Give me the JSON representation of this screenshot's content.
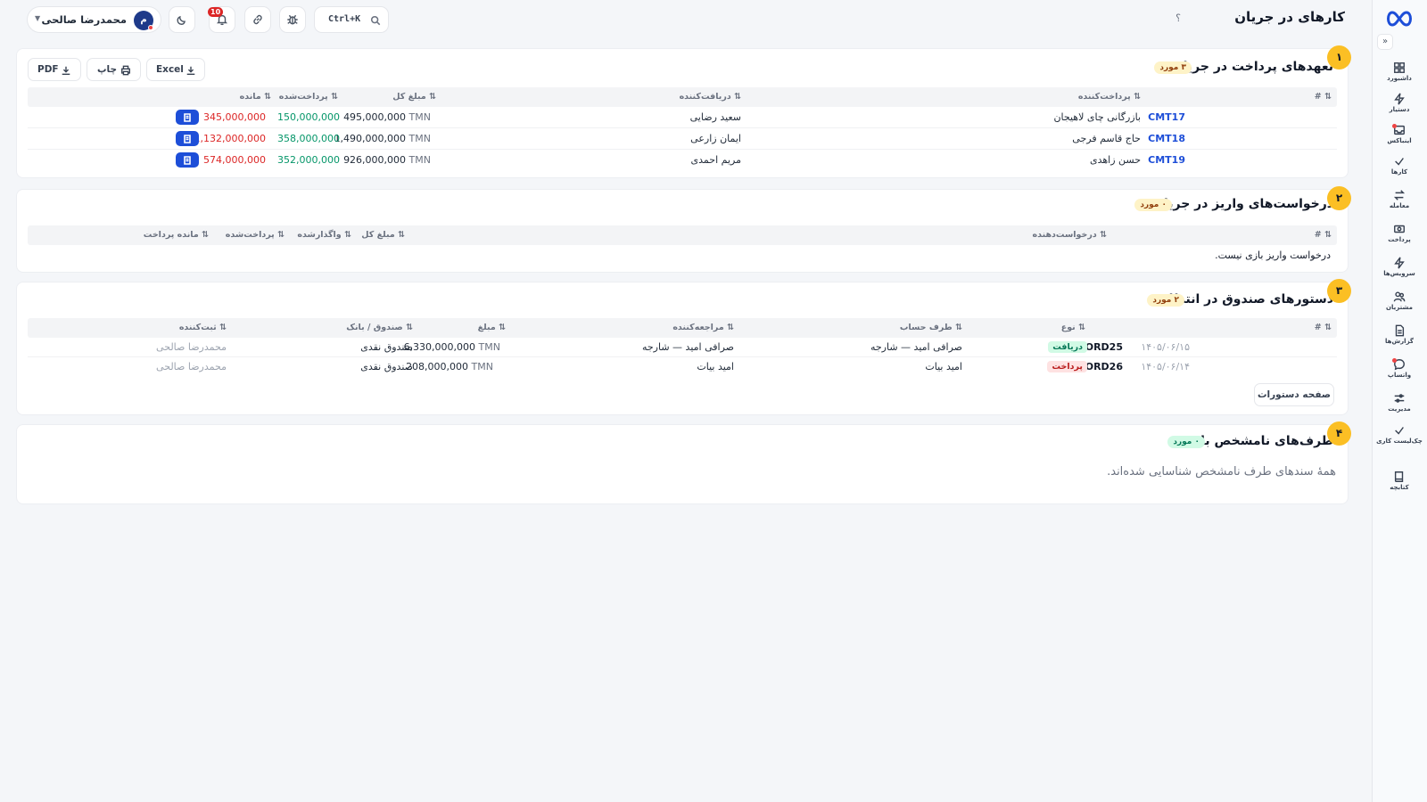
{
  "header": {
    "title": "کارهای در جریان",
    "help": "؟",
    "search_shortcut": "Ctrl+K",
    "notifications_count": "10",
    "user": {
      "name": "محمدرضا صالحی",
      "initial": "م"
    }
  },
  "sidebar": {
    "items": [
      {
        "label": "داشبورد",
        "icon": "dashboard-icon"
      },
      {
        "label": "دستیار",
        "icon": "bolt-icon"
      },
      {
        "label": "اینباکس",
        "icon": "inbox-icon"
      },
      {
        "label": "کارها",
        "icon": "check-icon"
      },
      {
        "label": "معامله",
        "icon": "exchange-icon"
      },
      {
        "label": "پرداخت",
        "icon": "payment-icon"
      },
      {
        "label": "سرویس‌ها",
        "icon": "bolt-icon"
      },
      {
        "label": "مشتریان",
        "icon": "users-icon"
      },
      {
        "label": "گزارش‌ها",
        "icon": "report-icon"
      },
      {
        "label": "واتساپ",
        "icon": "chat-icon"
      },
      {
        "label": "مدیریت",
        "icon": "sliders-icon"
      },
      {
        "label": "چک‌لیست کاری",
        "icon": "check-icon"
      },
      {
        "label": "کتابچه",
        "icon": "book-icon"
      }
    ]
  },
  "section1": {
    "number": "۱",
    "title": "تعهدهای پرداخت در جریان",
    "count": "۳ مورد",
    "toolbar": {
      "excel": "Excel",
      "print": "چاپ",
      "pdf": "PDF"
    },
    "columns": {
      "num": "#",
      "payer": "پرداخت‌کننده",
      "receiver": "دریافت‌کننده",
      "total": "مبلغ کل",
      "paid": "پرداخت‌شده",
      "remaining": "مانده"
    },
    "rows": [
      {
        "code": "CMT17",
        "payer": "بازرگانی چای لاهیجان",
        "receiver": "سعید رضایی",
        "total": "495,000,000",
        "unit": "TMN",
        "paid": "150,000,000",
        "remaining": "345,000,000"
      },
      {
        "code": "CMT18",
        "payer": "حاج قاسم فرجی",
        "receiver": "ایمان زارعی",
        "total": "1,490,000,000",
        "unit": "TMN",
        "paid": "358,000,000",
        "remaining": "1,132,000,000"
      },
      {
        "code": "CMT19",
        "payer": "حسن زاهدی",
        "receiver": "مریم احمدی",
        "total": "926,000,000",
        "unit": "TMN",
        "paid": "352,000,000",
        "remaining": "574,000,000"
      }
    ]
  },
  "section2": {
    "number": "۲",
    "title": "درخواست‌های واریز در جریان",
    "count": "۰ مورد",
    "columns": {
      "num": "#",
      "requester": "درخواست‌دهنده",
      "total": "مبلغ کل",
      "assigned": "واگذارشده",
      "paid": "پرداخت‌شده",
      "remaining": "مانده پرداخت"
    },
    "empty": "درخواست واریز بازی نیست."
  },
  "section3": {
    "number": "۳",
    "title": "دستورهای صندوق در انتظار",
    "count": "۲ مورد",
    "columns": {
      "num": "#",
      "type": "نوع",
      "counterparty": "طرف حساب",
      "client": "مراجعه‌کننده",
      "amount": "مبلغ",
      "fund": "صندوق / بانک",
      "registrar": "ثبت‌کننده"
    },
    "rows": [
      {
        "date": "۱۴۰۵/۰۶/۱۵",
        "code": "ORD25",
        "type": "دریافت",
        "type_kind": "receive",
        "counterparty": "صرافی امید — شارجه",
        "client": "صرافی امید — شارجه",
        "amount": "6,330,000,000",
        "unit": "TMN",
        "fund": "صندوق نقدی",
        "registrar": "محمدرضا صالحی"
      },
      {
        "date": "۱۴۰۵/۰۶/۱۴",
        "code": "ORD26",
        "type": "پرداخت",
        "type_kind": "pay",
        "counterparty": "امید بیات",
        "client": "امید بیات",
        "amount": "208,000,000",
        "unit": "TMN",
        "fund": "صندوق نقدی",
        "registrar": "محمدرضا صالحی"
      }
    ],
    "page_button": "صفحه دستورات"
  },
  "section4": {
    "number": "۴",
    "title": "طرف‌های نامشخص باز",
    "count": "۰ مورد",
    "message": "همهٔ سندهای طرف نامشخص شناسایی شده‌اند."
  },
  "colors": {
    "accent": "#1d4ed8",
    "badge": "#fbbf24",
    "negative": "#dc2626",
    "positive": "#059669"
  }
}
